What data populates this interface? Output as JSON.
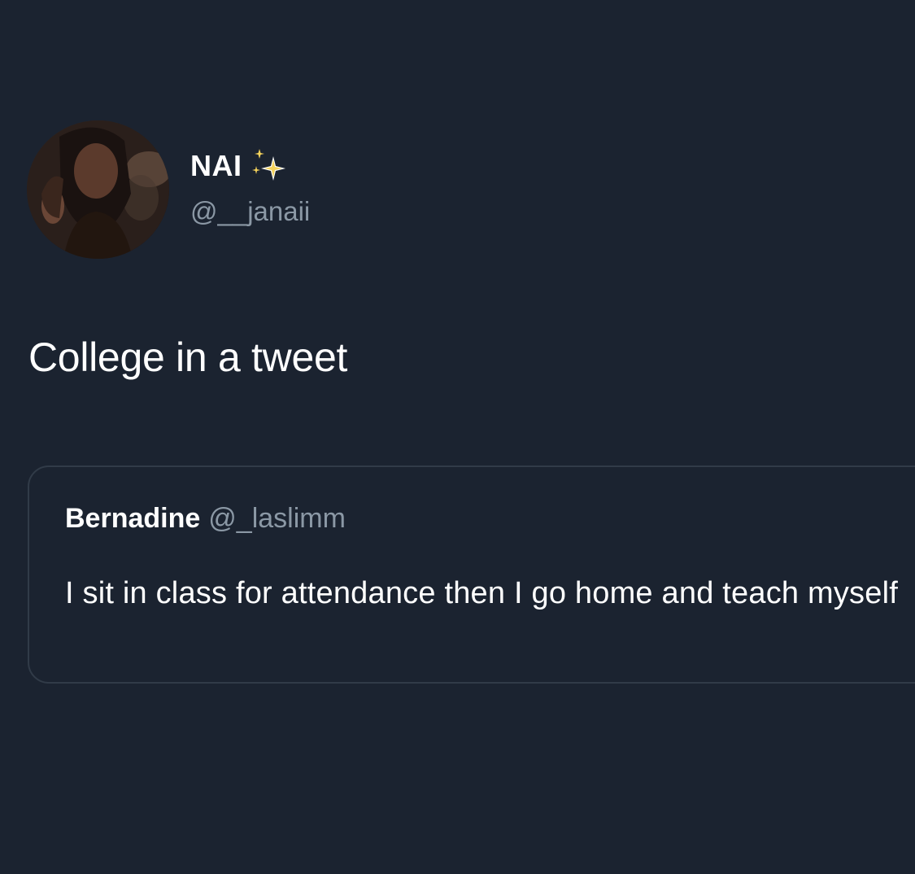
{
  "tweet": {
    "author": {
      "display_name": "NAI",
      "name_icon": "sparkles-icon",
      "handle": "@__janaii",
      "avatar": "avatar"
    },
    "text": "College in a tweet",
    "quoted_tweet": {
      "author_name": "Bernadine",
      "author_handle": "@_laslimm",
      "text": "I sit in class for attendance then I go home and teach myself"
    }
  },
  "colors": {
    "background": "#1b2330",
    "primary_text": "#ffffff",
    "secondary_text": "#8b98a5",
    "border": "#313b48",
    "sparkle": "#f5d35c"
  }
}
